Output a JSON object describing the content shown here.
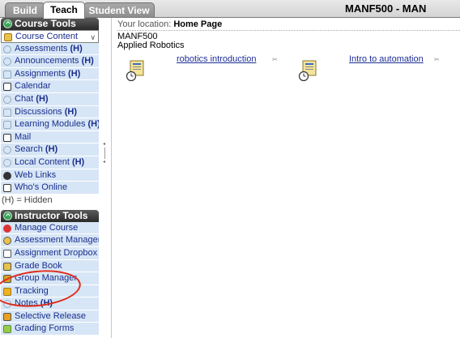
{
  "tabs": {
    "build": "Build",
    "teach": "Teach",
    "student_view": "Student View"
  },
  "course_title": "MANF500 - MAN",
  "course_tools": {
    "header": "Course Tools",
    "items": [
      {
        "label": "Course Content",
        "hidden": ""
      },
      {
        "label": "Assessments ",
        "hidden": "(H)"
      },
      {
        "label": "Announcements ",
        "hidden": "(H)"
      },
      {
        "label": "Assignments ",
        "hidden": "(H)"
      },
      {
        "label": "Calendar",
        "hidden": ""
      },
      {
        "label": "Chat ",
        "hidden": "(H)"
      },
      {
        "label": "Discussions ",
        "hidden": "(H)"
      },
      {
        "label": "Learning Modules ",
        "hidden": "(H)"
      },
      {
        "label": "Mail",
        "hidden": ""
      },
      {
        "label": "Search ",
        "hidden": "(H)"
      },
      {
        "label": "Local Content ",
        "hidden": "(H)"
      },
      {
        "label": "Web Links",
        "hidden": ""
      },
      {
        "label": "Who's Online",
        "hidden": ""
      }
    ],
    "hidden_note": "(H) = Hidden"
  },
  "instructor_tools": {
    "header": "Instructor Tools",
    "items": [
      {
        "label": "Manage Course",
        "hidden": ""
      },
      {
        "label": "Assessment Manager",
        "hidden": ""
      },
      {
        "label": "Assignment Dropbox",
        "hidden": ""
      },
      {
        "label": "Grade Book",
        "hidden": ""
      },
      {
        "label": "Group Manager",
        "hidden": ""
      },
      {
        "label": "Tracking",
        "hidden": ""
      },
      {
        "label": "Notes ",
        "hidden": "(H)"
      },
      {
        "label": "Selective Release",
        "hidden": ""
      },
      {
        "label": "Grading Forms",
        "hidden": ""
      }
    ]
  },
  "main": {
    "location_prefix": "Your location: ",
    "location": "Home Page",
    "course_code": "MANF500",
    "course_name": "Applied Robotics",
    "content_items": [
      {
        "label": "robotics introduction",
        "icon": "learning-module-icon"
      },
      {
        "label": "Intro to automation",
        "icon": "learning-module-icon"
      }
    ]
  },
  "colors": {
    "sidebar_item_bg": "#d7e6f6",
    "link": "#1d2f95",
    "header_dark": "#3a3a3a",
    "annotation": "#e02a18"
  }
}
